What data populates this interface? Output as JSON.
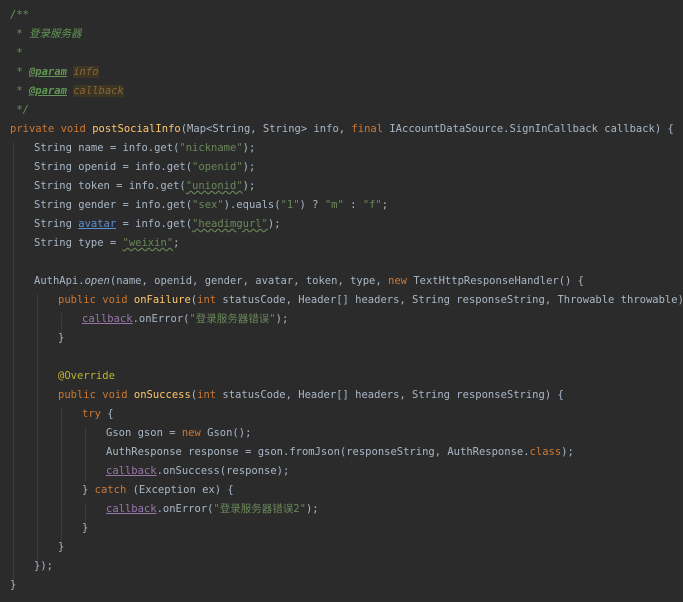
{
  "code": {
    "comment_open": "/**",
    "comment_desc": " * 登录服务器",
    "comment_blank": " *",
    "comment_star": " * ",
    "param_tag": "@param",
    "param_info": "info",
    "param_callback": "callback",
    "comment_close": " */",
    "kw_private": "private",
    "kw_void": "void",
    "method_post": "postSocialInfo",
    "sig_params_a": "(Map<String, String> info, ",
    "kw_final": "final",
    "sig_params_b": " IAccountDataSource.SignInCallback callback) {",
    "s_name_a": "String name = info.get(",
    "s_name_str": "\"nickname\"",
    "s_end": ");",
    "s_openid_a": "String openid = info.get(",
    "s_openid_str": "\"openid\"",
    "s_token_a": "String token = info.get(",
    "s_token_str": "\"unionid\"",
    "s_gender_a": "String gender = info.get(",
    "s_gender_str": "\"sex\"",
    "s_gender_b": ").equals(",
    "s_gender_one": "\"1\"",
    "s_gender_c": ") ? ",
    "s_gender_m": "\"m\"",
    "s_gender_d": " : ",
    "s_gender_f": "\"f\"",
    "s_gender_e": ";",
    "s_avatar_a": "String ",
    "s_avatar_var": "avatar",
    "s_avatar_b": " = info.get(",
    "s_avatar_str": "\"headimgurl\"",
    "s_type_a": "String type = ",
    "s_type_str": "\"weixin\"",
    "s_type_e": ";",
    "api_a": "AuthApi.",
    "api_open": "open",
    "api_b": "(name, openid, gender, avatar, token, type, ",
    "kw_new": "new",
    "api_c": " TextHttpResponseHandler() {",
    "kw_public": "public",
    "m_onfailure": "onFailure",
    "kw_int": "int",
    "fail_params": " statusCode, Header[] headers, String responseString, Throwable throwable) {",
    "field_callback": "callback",
    "onerror_a": ".onError(",
    "onerror_str": "\"登录服务器错误\"",
    "brace_close": "}",
    "annotation_override": "@Override",
    "m_onsuccess": "onSuccess",
    "succ_params": " statusCode, Header[] headers, String responseString) {",
    "kw_try": "try",
    "try_b": " {",
    "gson_a": "Gson gson = ",
    "gson_b": " Gson();",
    "resp_a": "AuthResponse response = gson.fromJson(responseString, AuthResponse.",
    "kw_class": "class",
    "resp_b": ");",
    "onsuccess_call": ".onSuccess(response);",
    "catch_a": "} ",
    "kw_catch": "catch",
    "catch_b": " (Exception ex) {",
    "onerror2_str": "\"登录服务器错误2\"",
    "close_anon": "});",
    "close_method": "}"
  }
}
